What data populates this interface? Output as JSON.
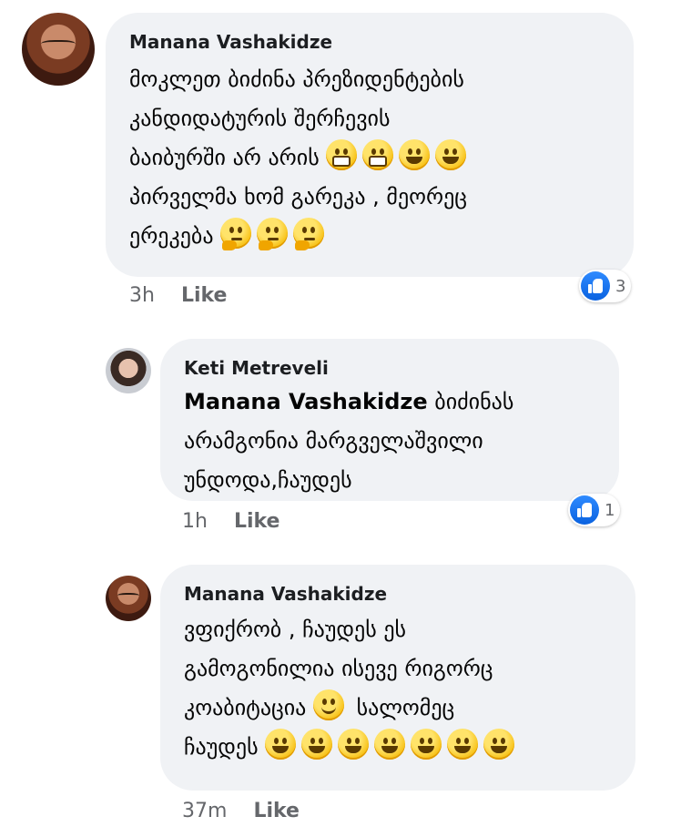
{
  "comments": [
    {
      "author": "Manana Vashakidze",
      "lines": [
        "მოკლეთ ბიძინა პრეზიდენტების",
        "კანდიდატურის შერჩევის",
        "ბაიბურში არ არის",
        "პირველმა ხომ გარეკა , მეორეც",
        "ერეკება"
      ],
      "emojis_line3": [
        "grimacing-face",
        "grimacing-face",
        "grinning-face",
        "grinning-face"
      ],
      "emojis_line5": [
        "thinking-face",
        "thinking-face",
        "thinking-face"
      ],
      "time": "3h",
      "like_label": "Like",
      "reaction_count": "3"
    },
    {
      "author": "Keti Metreveli",
      "mention": "Manana Vashakidze",
      "lines": [
        "ბიძინას",
        "არამგონია მარგველაშვილი",
        "უნდოდა,ჩაუდეს"
      ],
      "time": "1h",
      "like_label": "Like",
      "reaction_count": "1"
    },
    {
      "author": "Manana Vashakidze",
      "lines": [
        "ვფიქრობ , ჩაუდეს ეს",
        "გამოგონილია ისევე რიგორც",
        "კოაბიტაცია",
        "სალომეც",
        "ჩაუდეს"
      ],
      "emoji_line3": "slightly-smiling-face",
      "emojis_line4": [
        "grinning-face",
        "grinning-face",
        "grinning-face",
        "grinning-face",
        "grinning-face",
        "grinning-face",
        "grinning-face"
      ],
      "time": "37m",
      "like_label": "Like"
    }
  ],
  "colors": {
    "bubble": "#f0f2f5",
    "meta_text": "#65676b",
    "like_blue": "#1877f2"
  }
}
